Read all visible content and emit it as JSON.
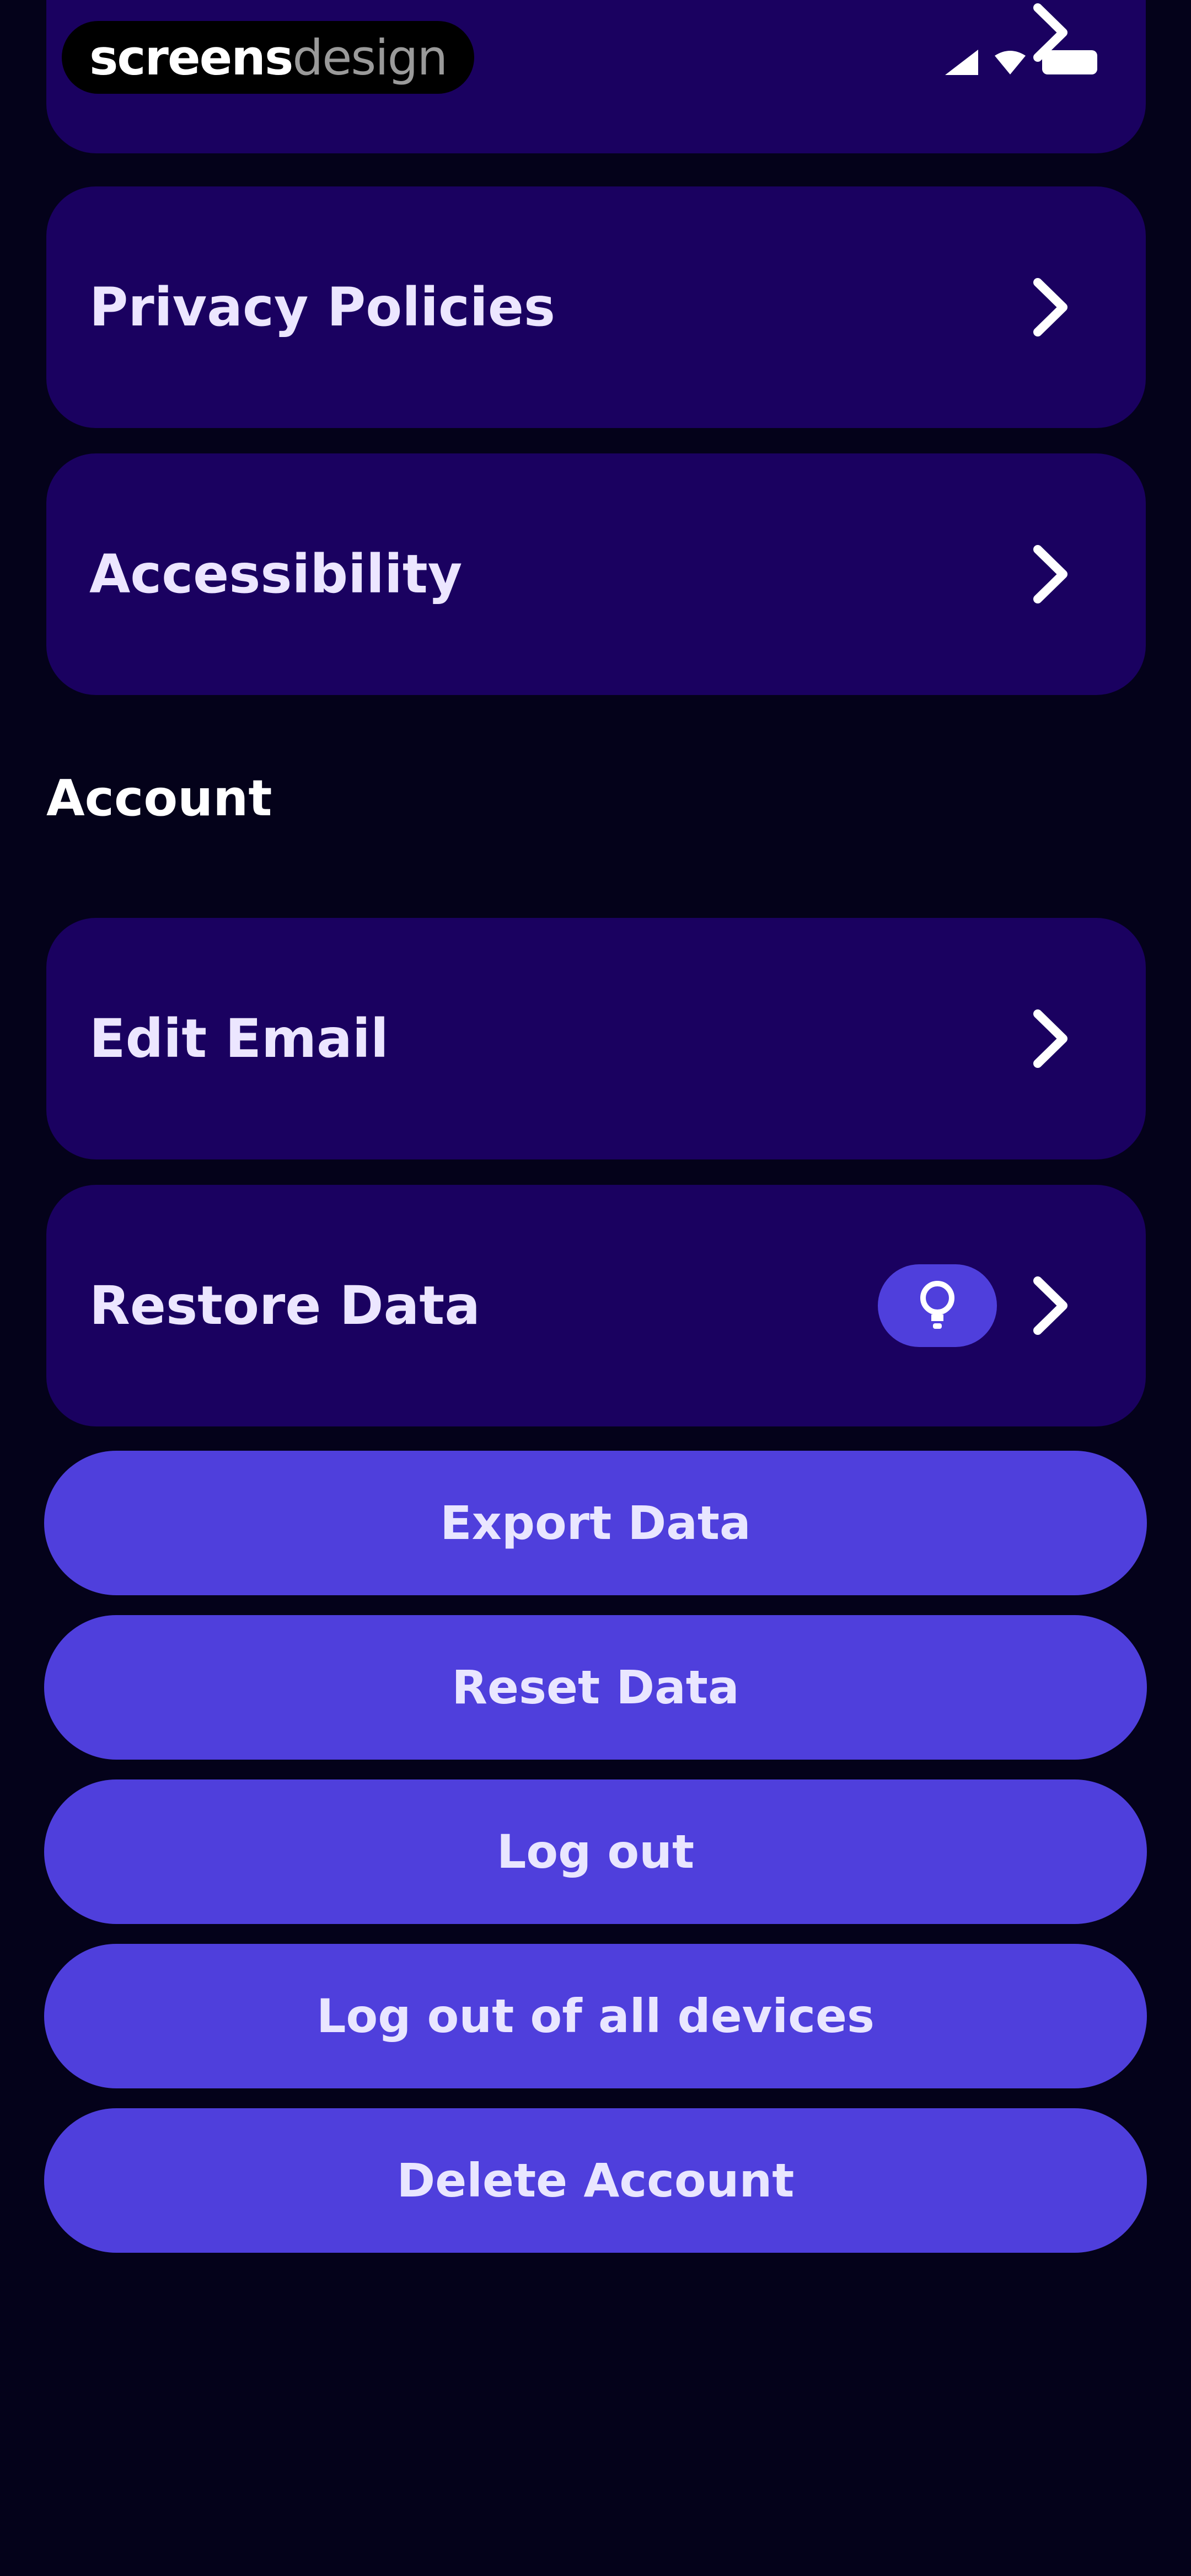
{
  "watermark": {
    "part1": "screens",
    "part2": "design"
  },
  "status_bar": {
    "battery": "battery-icon",
    "wifi": "wifi-icon",
    "signal": "signal-icon"
  },
  "settings_items": [
    {
      "label": "Privacy Policies",
      "icon": "chevron-right-icon"
    },
    {
      "label": "Accessibility",
      "icon": "chevron-right-icon"
    }
  ],
  "account": {
    "title": "Account",
    "items": [
      {
        "label": "Edit Email",
        "icon": "chevron-right-icon"
      },
      {
        "label": "Restore Data",
        "badge_icon": "lightbulb-icon",
        "icon": "chevron-right-icon"
      }
    ]
  },
  "actions": [
    {
      "label": "Export Data"
    },
    {
      "label": "Reset Data"
    },
    {
      "label": "Log out"
    },
    {
      "label": "Log out of all devices"
    },
    {
      "label": "Delete Account"
    }
  ],
  "colors": {
    "background": "#04021a",
    "card": "#1a0160",
    "accent": "#4f3fdc",
    "text": "#ece6ff"
  }
}
